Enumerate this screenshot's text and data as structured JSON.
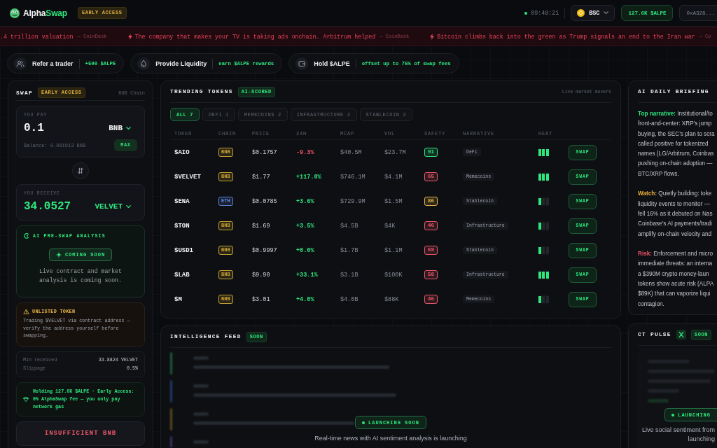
{
  "topbar": {
    "logo": {
      "primary": "Alpha",
      "accent": "Swap"
    },
    "badge": "EARLY ACCESS",
    "clock": "09:48:21",
    "network": "BSC",
    "balance": "127.6K $ALPE",
    "wallet": "0xA328..."
  },
  "ticker": [
    {
      "kind": "plain",
      "headline": ".4 trillion valuation",
      "source": "— CoinDesk"
    },
    {
      "kind": "flash",
      "headline": "The company that makes your TV is taking ads onchain. Arbitrum helped",
      "source": "— CoinDesk"
    },
    {
      "kind": "flash",
      "headline": "Bitcoin climbs back into the green as Trump signals an end to the Iran war",
      "source": "— Co"
    }
  ],
  "promos": [
    {
      "kind": "referral",
      "label": "Refer a trader",
      "reward": "+500 $ALPE"
    },
    {
      "kind": "liquidity",
      "label": "Provide Liquidity",
      "reward": "earn $ALPE rewards"
    },
    {
      "kind": "hold",
      "label": "Hold $ALPE",
      "reward": "offset up to 75% of swap fees"
    }
  ],
  "swap": {
    "title": "SWAP",
    "badge": "EARLY ACCESS",
    "chain": "BNB Chain",
    "pay": {
      "label": "YOU PAY",
      "amount": "0.1",
      "token": "BNB",
      "balance": "Balance: 0.001913 BNB",
      "max": "MAX"
    },
    "receive": {
      "label": "YOU RECEIVE",
      "amount": "34.0527",
      "token": "VELVET"
    },
    "analysis": {
      "title": "AI PRE-SWAP ANALYSIS",
      "status": "COMING SOON",
      "text": "Live contract and market analysis is coming soon."
    },
    "warning": {
      "title": "UNLISTED TOKEN",
      "text": "Trading $VELVET via contract address — verify the address yourself before swapping."
    },
    "details": [
      {
        "label": "Min received",
        "value": "33.8824 VELVET"
      },
      {
        "label": "Slippage",
        "value": "0.5%"
      }
    ],
    "perk": "Holding 127.6K $ALPE · Early Access: 0% AlphaSwap fee — you only pay network gas",
    "action": {
      "label": "INSUFFICIENT BNB",
      "disabled": true
    }
  },
  "tokens": {
    "title": "TRENDING TOKENS",
    "badge": "AI-SCORED",
    "subtitle": "Live market movers",
    "filters": [
      {
        "label": "ALL",
        "count": "7",
        "selected": true
      },
      {
        "label": "DEFI",
        "count": "1",
        "selected": false
      },
      {
        "label": "MEMECOINS",
        "count": "2",
        "selected": false
      },
      {
        "label": "INFRASTRUCTURE",
        "count": "2",
        "selected": false
      },
      {
        "label": "STABLECOIN",
        "count": "2",
        "selected": false
      }
    ],
    "columns": [
      "TOKEN",
      "CHAIN",
      "PRICE",
      "24H",
      "MCAP",
      "VOL",
      "SAFETY",
      "NARRATIVE",
      "HEAT"
    ],
    "rows": [
      {
        "token": "$AIO",
        "chain": {
          "label": "BNB",
          "color": "#c9a030"
        },
        "price": "$0.1757",
        "change": "-9.3%",
        "falling": true,
        "mcap": "$40.5M",
        "vol": "$23.7M",
        "safety": {
          "score": "91",
          "color": "#2ee87f"
        },
        "narrative": "DeFi",
        "heat": {
          "level": 1
        },
        "action": "SWAP"
      },
      {
        "token": "$VELVET",
        "chain": {
          "label": "BNB",
          "color": "#c9a030"
        },
        "price": "$1.77",
        "change": "+117.0%",
        "falling": false,
        "mcap": "$746.1M",
        "vol": "$4.1M",
        "safety": {
          "score": "65",
          "color": "#f0566a"
        },
        "narrative": "Memecoins",
        "heat": {
          "level": 1
        },
        "action": "SWAP"
      },
      {
        "token": "$ENA",
        "chain": {
          "label": "ETH",
          "color": "#5f84dc"
        },
        "price": "$0.0785",
        "change": "+3.6%",
        "falling": false,
        "mcap": "$729.9M",
        "vol": "$1.5M",
        "safety": {
          "score": "86",
          "color": "#e9b949"
        },
        "narrative": "Stablecoin",
        "heat": {
          "level": 0.33
        },
        "action": "SWAP"
      },
      {
        "token": "$TON",
        "chain": {
          "label": "BNB",
          "color": "#c9a030"
        },
        "price": "$1.69",
        "change": "+3.5%",
        "falling": false,
        "mcap": "$4.5B",
        "vol": "$4K",
        "safety": {
          "score": "46",
          "color": "#f0566a"
        },
        "narrative": "Infrastructure",
        "heat": {
          "level": 0.33
        },
        "action": "SWAP"
      },
      {
        "token": "$USD1",
        "chain": {
          "label": "BNB",
          "color": "#c9a030"
        },
        "price": "$0.9997",
        "change": "+0.0%",
        "falling": false,
        "mcap": "$1.7B",
        "vol": "$1.1M",
        "safety": {
          "score": "69",
          "color": "#f0566a"
        },
        "narrative": "Stablecoin",
        "heat": {
          "level": 0.33
        },
        "action": "SWAP"
      },
      {
        "token": "$LAB",
        "chain": {
          "label": "BNB",
          "color": "#c9a030"
        },
        "price": "$9.90",
        "change": "+33.1%",
        "falling": false,
        "mcap": "$3.1B",
        "vol": "$100K",
        "safety": {
          "score": "58",
          "color": "#f0566a"
        },
        "narrative": "Infrastructure",
        "heat": {
          "level": 1
        },
        "action": "SWAP"
      },
      {
        "token": "$M",
        "chain": {
          "label": "BNB",
          "color": "#c9a030"
        },
        "price": "$3.01",
        "change": "+4.0%",
        "falling": false,
        "mcap": "$4.0B",
        "vol": "$88K",
        "safety": {
          "score": "46",
          "color": "#f0566a"
        },
        "narrative": "Memecoins",
        "heat": {
          "level": 0.33
        },
        "action": "SWAP"
      }
    ]
  },
  "feed": {
    "title": "INTELLIGENCE FEED",
    "badge": "SOON",
    "status": "LAUNCHING SOON",
    "note": "Real-time news with AI sentiment analysis is launching"
  },
  "briefing": {
    "title": "AI DAILY BRIEFING",
    "sections": [
      {
        "kind": "narrative",
        "lines": [
          "**Top narrative:** Institutional/to",
          "front-and-center: XRP’s jump",
          "buying, the SEC’s plan to scra",
          "called positive for tokenized",
          "names (LG/Arbitrum, Coinbas",
          "pushing on-chain adoption —",
          "BTC/XRP flows."
        ]
      },
      {
        "kind": "watch",
        "lines": [
          "**Watch:** Quietly building: toke",
          "liquidity events to monitor —",
          "fell 16% as it debuted on Nas",
          "Coinbase’s AI payments/tradi",
          "amplify on-chain velocity and"
        ]
      },
      {
        "kind": "risk",
        "lines": [
          "**Risk:** Enforcement and micro",
          "immediate threats: an interna",
          "a $390M crypto money-laun",
          "tokens show acute risk (ALPA",
          "$89K) that can vaporize liqui",
          "contagion."
        ]
      }
    ]
  },
  "pulse": {
    "title": "CT PULSE",
    "badge": "SOON",
    "status": "LAUNCHING",
    "note_lines": [
      "Live social sentiment from",
      "launching"
    ]
  }
}
